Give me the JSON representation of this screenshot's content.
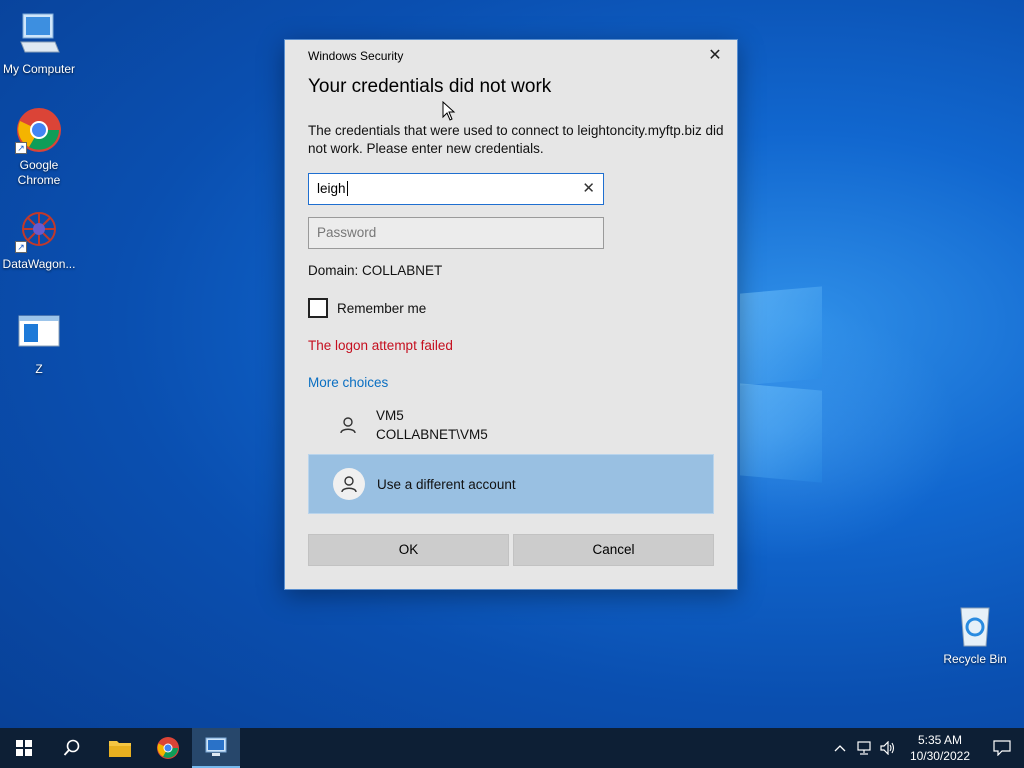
{
  "desktop": {
    "icons": [
      {
        "label": "My Computer"
      },
      {
        "label": "Google Chrome"
      },
      {
        "label": "DataWagon..."
      },
      {
        "label": "Z"
      }
    ],
    "recycle_bin": "Recycle Bin"
  },
  "dialog": {
    "window_title": "Windows Security",
    "close_glyph": "✕",
    "heading": "Your credentials did not work",
    "message": "The credentials that were used to connect to leightoncity.myftp.biz did not work. Please enter new credentials.",
    "username_value": "leigh",
    "clear_glyph": "✕",
    "password_placeholder": "Password",
    "domain_text": "Domain: COLLABNET",
    "remember_label": "Remember me",
    "error_text": "The logon attempt failed",
    "more_choices": "More choices",
    "accounts": [
      {
        "name": "VM5",
        "sub": "COLLABNET\\VM5"
      },
      {
        "name": "Use a different account"
      }
    ],
    "ok_label": "OK",
    "cancel_label": "Cancel"
  },
  "taskbar": {
    "time": "5:35 AM",
    "date": "10/30/2022"
  },
  "colors": {
    "error": "#c50f1f",
    "link": "#0a6fc2",
    "selected_account": "#99c0e2",
    "taskbar": "#0d1f35"
  }
}
